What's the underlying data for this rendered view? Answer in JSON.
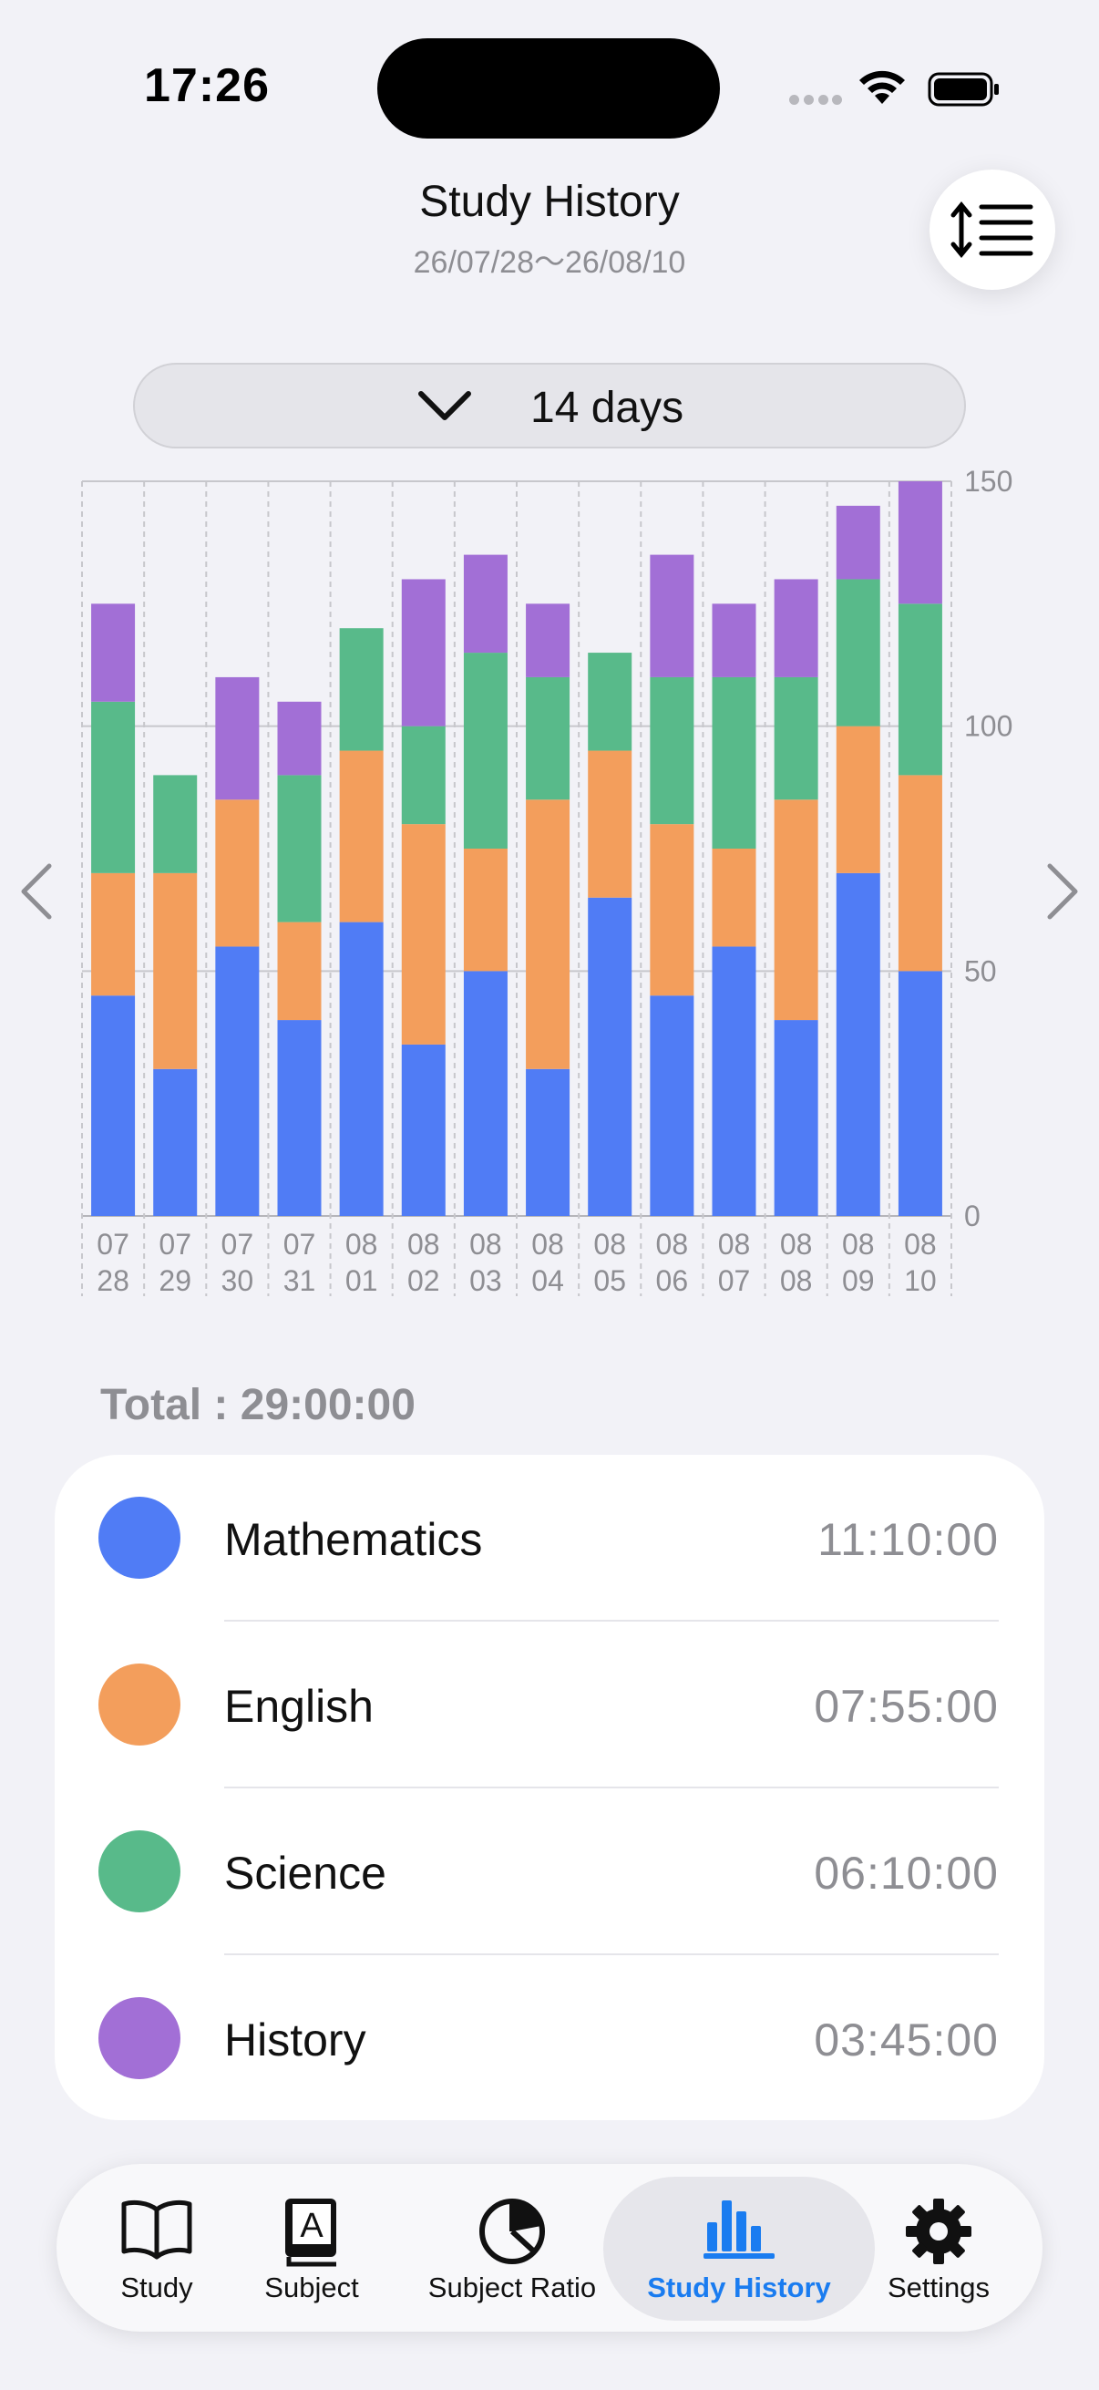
{
  "status": {
    "time": "17:26"
  },
  "header": {
    "title": "Study History",
    "subtitle": "26/07/28～26/08/10"
  },
  "range": {
    "label": "14 days"
  },
  "colors": {
    "mathematics": "#507cf5",
    "english": "#f39e5c",
    "science": "#58ba8a",
    "history": "#a26fd6",
    "accent": "#1a7cf0"
  },
  "chart_data": {
    "type": "bar",
    "stacked": true,
    "categories": [
      [
        "07",
        "28"
      ],
      [
        "07",
        "29"
      ],
      [
        "07",
        "30"
      ],
      [
        "07",
        "31"
      ],
      [
        "08",
        "01"
      ],
      [
        "08",
        "02"
      ],
      [
        "08",
        "03"
      ],
      [
        "08",
        "04"
      ],
      [
        "08",
        "05"
      ],
      [
        "08",
        "06"
      ],
      [
        "08",
        "07"
      ],
      [
        "08",
        "08"
      ],
      [
        "08",
        "09"
      ],
      [
        "08",
        "10"
      ]
    ],
    "series": [
      {
        "name": "Mathematics",
        "color": "#507cf5",
        "values": [
          45,
          30,
          55,
          40,
          60,
          35,
          50,
          30,
          65,
          45,
          55,
          40,
          70,
          50
        ]
      },
      {
        "name": "English",
        "color": "#f39e5c",
        "values": [
          25,
          40,
          30,
          20,
          35,
          45,
          25,
          55,
          30,
          35,
          20,
          45,
          30,
          40
        ]
      },
      {
        "name": "Science",
        "color": "#58ba8a",
        "values": [
          35,
          20,
          0,
          30,
          25,
          20,
          40,
          25,
          20,
          30,
          35,
          25,
          30,
          35
        ]
      },
      {
        "name": "History",
        "color": "#a26fd6",
        "values": [
          20,
          0,
          25,
          15,
          0,
          30,
          20,
          15,
          0,
          25,
          15,
          20,
          15,
          25
        ]
      }
    ],
    "ylim": [
      0,
      150
    ],
    "yticks": [
      "0",
      "50",
      "100",
      "150"
    ],
    "grid": true,
    "axis_position": "right"
  },
  "summary": {
    "total": "Total : 29:00:00",
    "subjects": [
      {
        "name": "Mathematics",
        "time": "11:10:00",
        "color": "#507cf5"
      },
      {
        "name": "English",
        "time": "07:55:00",
        "color": "#f39e5c"
      },
      {
        "name": "Science",
        "time": "06:10:00",
        "color": "#58ba8a"
      },
      {
        "name": "History",
        "time": "03:45:00",
        "color": "#a26fd6"
      }
    ]
  },
  "tabs": [
    {
      "label": "Study",
      "icon": "book-icon"
    },
    {
      "label": "Subject",
      "icon": "dictionary-icon"
    },
    {
      "label": "Subject Ratio",
      "icon": "pie-chart-icon"
    },
    {
      "label": "Study History",
      "icon": "bar-chart-icon",
      "active": true
    },
    {
      "label": "Settings",
      "icon": "gear-icon"
    }
  ]
}
